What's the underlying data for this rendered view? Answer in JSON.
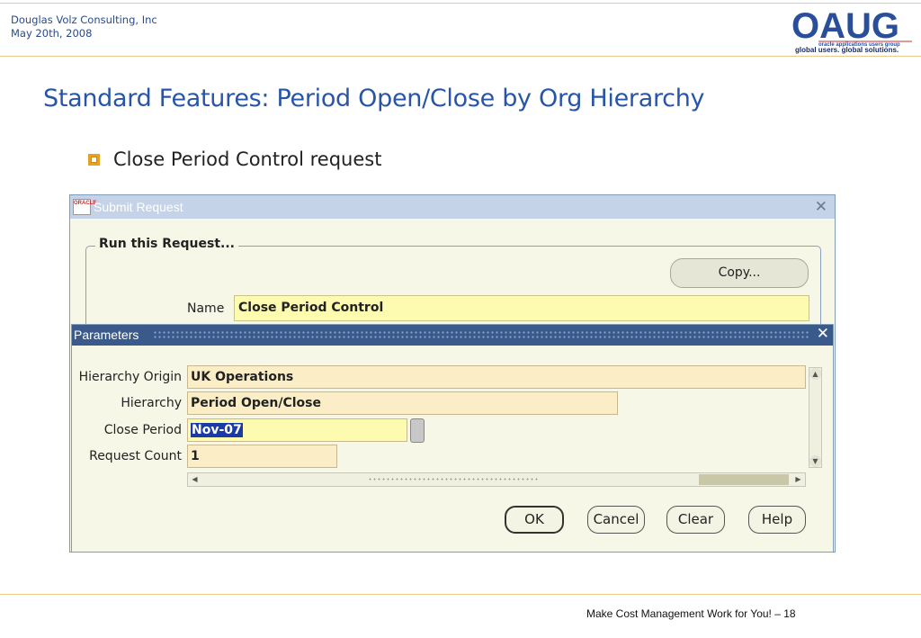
{
  "header": {
    "company": "Douglas Volz Consulting, Inc",
    "date": "May 20th, 2008",
    "logo_text": "OAUG",
    "logo_subtext": "oracle applications users group",
    "logo_tagline": "global users. global solutions."
  },
  "slide": {
    "title": "Standard Features:  Period Open/Close by Org Hierarchy",
    "bullet": "Close Period Control request"
  },
  "submit_window": {
    "icon_text": "ORACLE",
    "title": "Submit Request",
    "group_label": "Run this Request...",
    "copy_label": "Copy...",
    "name_label": "Name",
    "name_value": "Close Period Control"
  },
  "parameters": {
    "title": "Parameters",
    "fields": [
      {
        "label": "Hierarchy Origin",
        "value": "UK Operations"
      },
      {
        "label": "Hierarchy",
        "value": "Period Open/Close"
      },
      {
        "label": "Close Period",
        "value": "Nov-07"
      },
      {
        "label": "Request Count",
        "value": "1"
      }
    ],
    "buttons": {
      "ok": "OK",
      "cancel": "Cancel",
      "clear": "Clear",
      "help": "Help"
    }
  },
  "footer": {
    "text": "Make Cost Management Work for You! – 18"
  },
  "colors": {
    "title_blue": "#2855a8",
    "accent_orange": "#e8a020",
    "field_yellow": "#fdfbb0",
    "params_titlebar": "#3a5a8c"
  }
}
